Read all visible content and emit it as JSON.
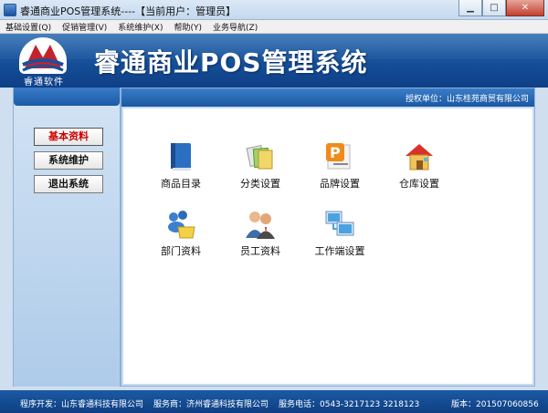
{
  "window": {
    "title": "睿通商业POS管理系统----【当前用户：管理员】"
  },
  "menu": [
    {
      "label": "基础设置(Q)"
    },
    {
      "label": "促销管理(V)"
    },
    {
      "label": "系统维护(X)"
    },
    {
      "label": "帮助(Y)"
    },
    {
      "label": "业务导航(Z)"
    }
  ],
  "header": {
    "logo_text": "睿通软件",
    "app_title": "睿通商业POS管理系统",
    "company": "授权单位：山东桂苑商贸有限公司"
  },
  "nav": [
    {
      "label": "基本资料",
      "active": true
    },
    {
      "label": "系统维护",
      "active": false
    },
    {
      "label": "退出系统",
      "active": false
    }
  ],
  "tiles": [
    {
      "label": "商品目录",
      "icon": "book-icon"
    },
    {
      "label": "分类设置",
      "icon": "category-icon"
    },
    {
      "label": "品牌设置",
      "icon": "brand-icon"
    },
    {
      "label": "仓库设置",
      "icon": "warehouse-icon"
    },
    {
      "label": "部门资料",
      "icon": "department-icon"
    },
    {
      "label": "员工资料",
      "icon": "employee-icon"
    },
    {
      "label": "工作端设置",
      "icon": "workstation-icon"
    }
  ],
  "status": {
    "developer": "程序开发：山东睿通科技有限公司",
    "service_provider": "服务商：济州睿通科技有限公司",
    "phone": "服务电话：0543-3217123 3218123",
    "version": "版本：201507060856"
  },
  "colors": {
    "brand_blue": "#1a58a3",
    "active_red": "#cc0000"
  }
}
